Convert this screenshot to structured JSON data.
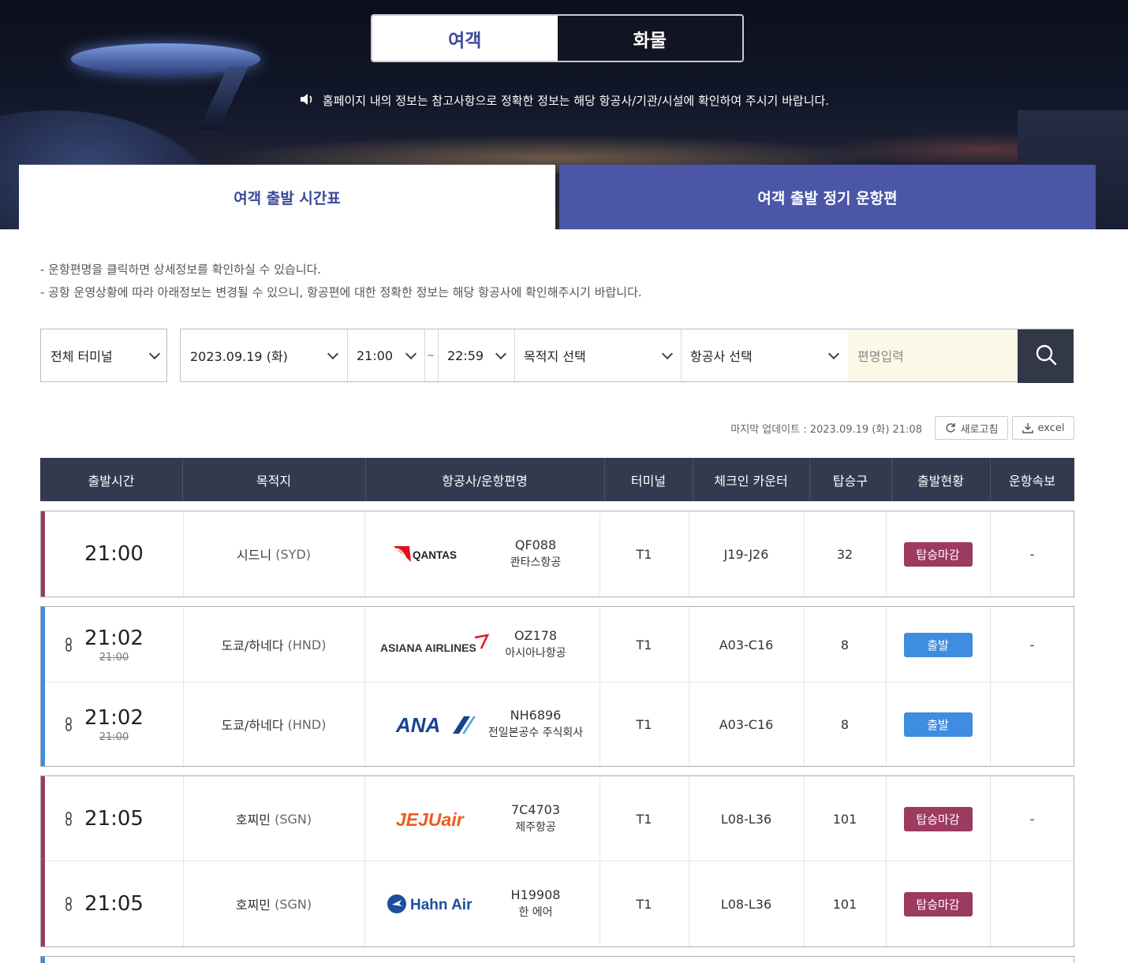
{
  "mode_tabs": {
    "passenger": "여객",
    "cargo": "화물"
  },
  "notice": "홈페이지 내의 정보는 참고사항으로 정확한 정보는 해당 항공사/기관/시설에 확인하여 주시기 바랍니다.",
  "sub_tabs": {
    "schedule": "여객 출발 시간표",
    "regular": "여객 출발 정기 운항편"
  },
  "info_lines": [
    "-  운항편명을 클릭하면 상세정보를 확인하실 수 있습니다.",
    "-  공항 운영상황에 따라 아래정보는 변경될 수 있으니, 항공편에 대한 정확한 정보는 해당 항공사에 확인해주시기 바랍니다."
  ],
  "filters": {
    "terminal": "전체 터미널",
    "date": "2023.09.19 (화)",
    "time_from": "21:00",
    "tilde": "~",
    "time_to": "22:59",
    "destination": "목적지 선택",
    "airline": "항공사 선택",
    "flight_placeholder": "편명입력"
  },
  "update": {
    "text": "마지막 업데이트 : 2023.09.19 (화) 21:08",
    "refresh": "새로고침",
    "excel": "excel"
  },
  "headers": [
    "출발시간",
    "목적지",
    "항공사/운항편명",
    "터미널",
    "체크인 카운터",
    "탑승구",
    "출발현황",
    "운항속보"
  ],
  "colors": {
    "closed": "#9c3a60",
    "departed": "#3f8de1",
    "header": "#343a4e",
    "accent": "#3a4796"
  },
  "flights": [
    {
      "time": "21:00",
      "old_time": "",
      "codeshare": false,
      "dest": "시드니",
      "dest_code": "(SYD)",
      "airline_logo": "qantas-logo",
      "logo_text": "QANTAS",
      "flight_no": "QF088",
      "airline": "콴타스항공",
      "terminal": "T1",
      "counter": "J19-J26",
      "gate": "32",
      "status": "탑승마감",
      "status_type": "closed",
      "news": "-"
    },
    {
      "time": "21:02",
      "old_time": "21:00",
      "codeshare": true,
      "dest": "도쿄/하네다",
      "dest_code": "(HND)",
      "airline_logo": "asiana-logo",
      "logo_text": "ASIANA AIRLINES",
      "flight_no": "OZ178",
      "airline": "아시아나항공",
      "terminal": "T1",
      "counter": "A03-C16",
      "gate": "8",
      "status": "출발",
      "status_type": "dep",
      "news": "-"
    },
    {
      "time": "21:02",
      "old_time": "21:00",
      "codeshare": true,
      "dest": "도쿄/하네다",
      "dest_code": "(HND)",
      "airline_logo": "ana-logo",
      "logo_text": "ANA",
      "flight_no": "NH6896",
      "airline": "전일본공수 주식회사",
      "terminal": "T1",
      "counter": "A03-C16",
      "gate": "8",
      "status": "출발",
      "status_type": "dep",
      "news": ""
    },
    {
      "time": "21:05",
      "old_time": "",
      "codeshare": true,
      "dest": "호찌민",
      "dest_code": "(SGN)",
      "airline_logo": "jejuair-logo",
      "logo_text": "JEJUair",
      "flight_no": "7C4703",
      "airline": "제주항공",
      "terminal": "T1",
      "counter": "L08-L36",
      "gate": "101",
      "status": "탑승마감",
      "status_type": "closed",
      "news": "-"
    },
    {
      "time": "21:05",
      "old_time": "",
      "codeshare": true,
      "dest": "호찌민",
      "dest_code": "(SGN)",
      "airline_logo": "hahnair-logo",
      "logo_text": "Hahn Air",
      "flight_no": "H19908",
      "airline": "한 에어",
      "terminal": "T1",
      "counter": "L08-L36",
      "gate": "101",
      "status": "탑승마감",
      "status_type": "closed",
      "news": ""
    }
  ]
}
